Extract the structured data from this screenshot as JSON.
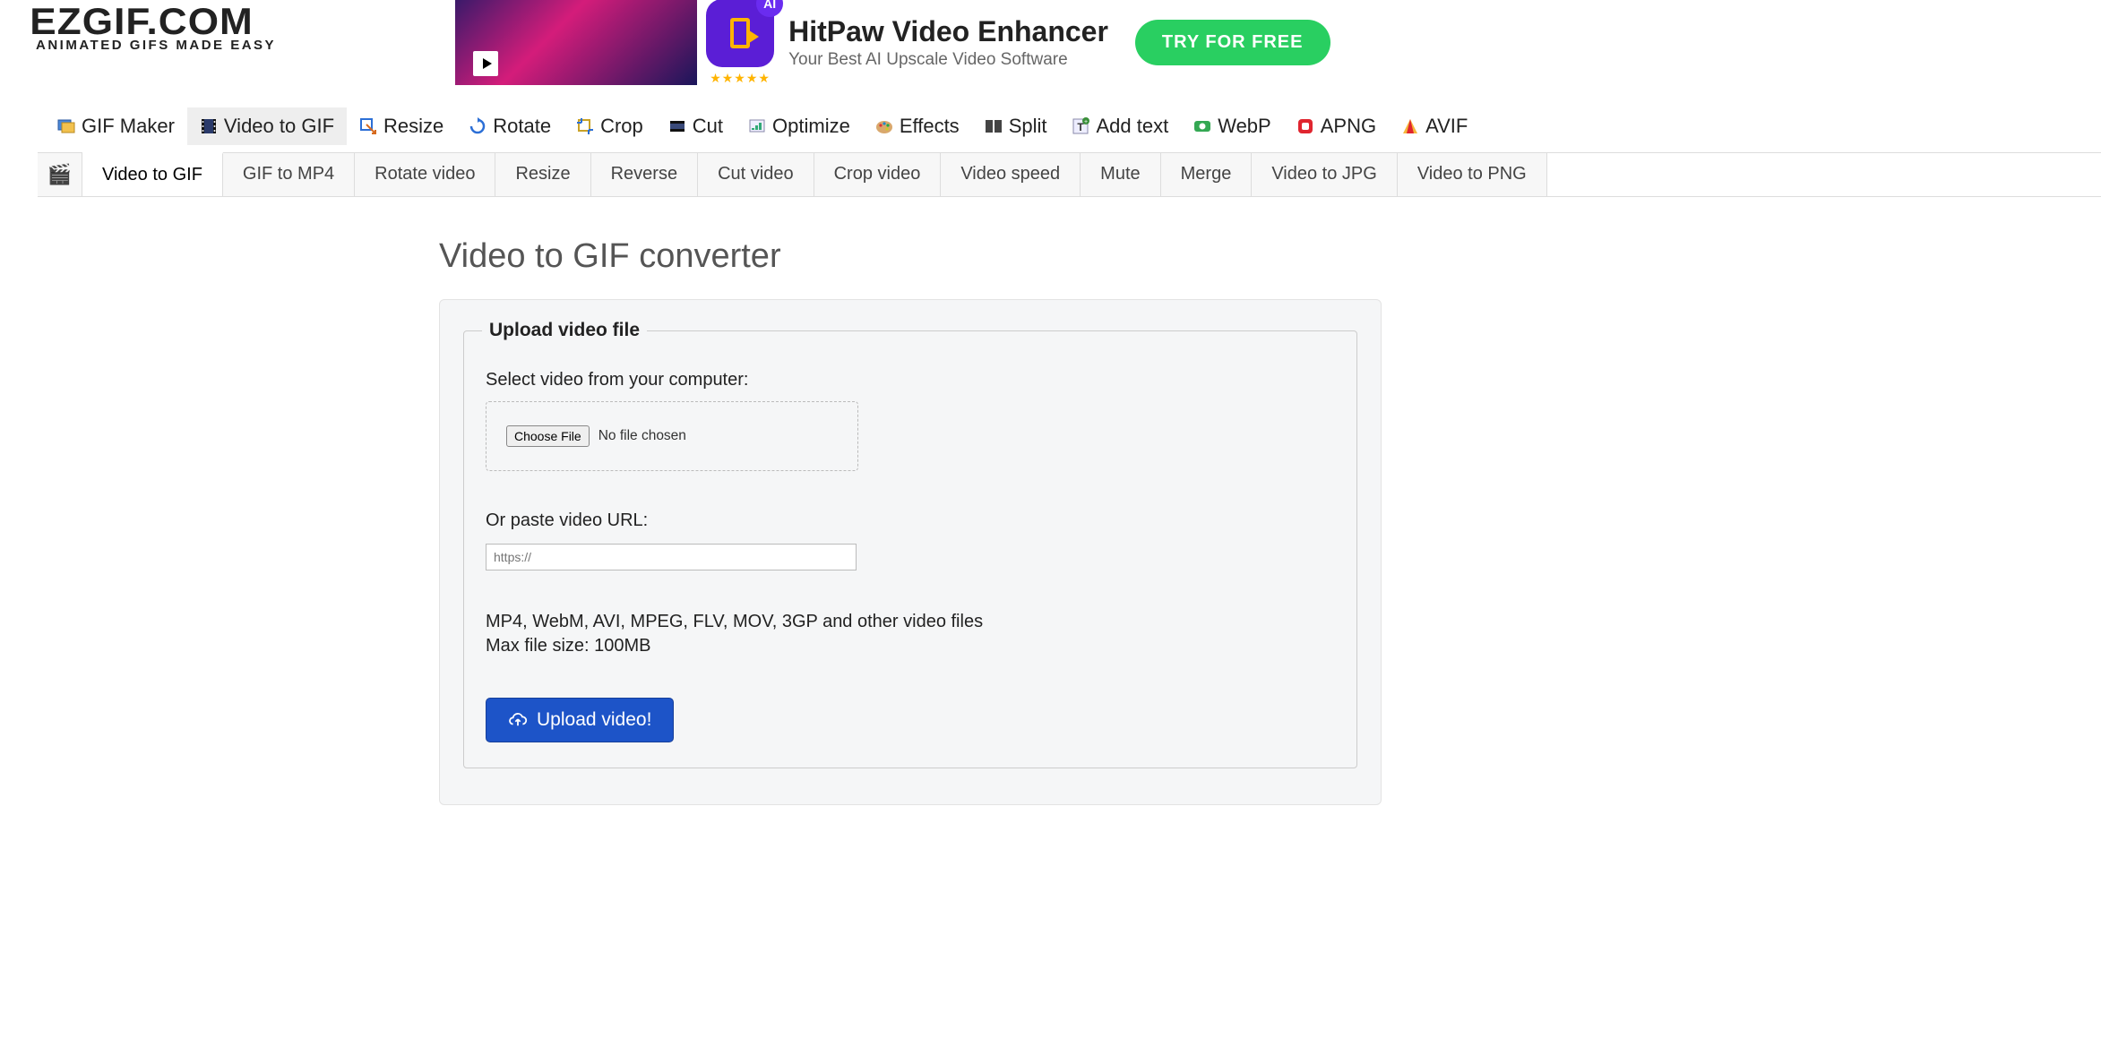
{
  "logo": {
    "main": "EZGIF.COM",
    "sub": "ANIMATED GIFS MADE EASY"
  },
  "ad": {
    "badge": "AI",
    "stars": "★★★★★",
    "title": "HitPaw Video Enhancer",
    "subtitle": "Your Best AI Upscale Video Software",
    "cta": "TRY FOR FREE"
  },
  "main_nav": [
    {
      "label": "GIF Maker",
      "icon": "gallery-icon"
    },
    {
      "label": "Video to GIF",
      "icon": "film-icon",
      "active": true
    },
    {
      "label": "Resize",
      "icon": "resize-icon"
    },
    {
      "label": "Rotate",
      "icon": "rotate-icon"
    },
    {
      "label": "Crop",
      "icon": "crop-icon"
    },
    {
      "label": "Cut",
      "icon": "cut-icon"
    },
    {
      "label": "Optimize",
      "icon": "optimize-icon"
    },
    {
      "label": "Effects",
      "icon": "palette-icon"
    },
    {
      "label": "Split",
      "icon": "split-icon"
    },
    {
      "label": "Add text",
      "icon": "addtext-icon"
    },
    {
      "label": "WebP",
      "icon": "webp-icon"
    },
    {
      "label": "APNG",
      "icon": "apng-icon"
    },
    {
      "label": "AVIF",
      "icon": "avif-icon"
    }
  ],
  "sub_nav": {
    "home_icon": "🎬",
    "items": [
      {
        "label": "Video to GIF",
        "active": true
      },
      {
        "label": "GIF to MP4"
      },
      {
        "label": "Rotate video"
      },
      {
        "label": "Resize"
      },
      {
        "label": "Reverse"
      },
      {
        "label": "Cut video"
      },
      {
        "label": "Crop video"
      },
      {
        "label": "Video speed"
      },
      {
        "label": "Mute"
      },
      {
        "label": "Merge"
      },
      {
        "label": "Video to JPG"
      },
      {
        "label": "Video to PNG"
      }
    ]
  },
  "page": {
    "title": "Video to GIF converter",
    "legend": "Upload video file",
    "select_label": "Select video from your computer:",
    "choose_file": "Choose File",
    "file_status": "No file chosen",
    "url_label": "Or paste video URL:",
    "url_placeholder": "https://",
    "hint_formats": "MP4, WebM, AVI, MPEG, FLV, MOV, 3GP and other video files",
    "hint_size": "Max file size: 100MB",
    "upload_button": "Upload video!"
  }
}
